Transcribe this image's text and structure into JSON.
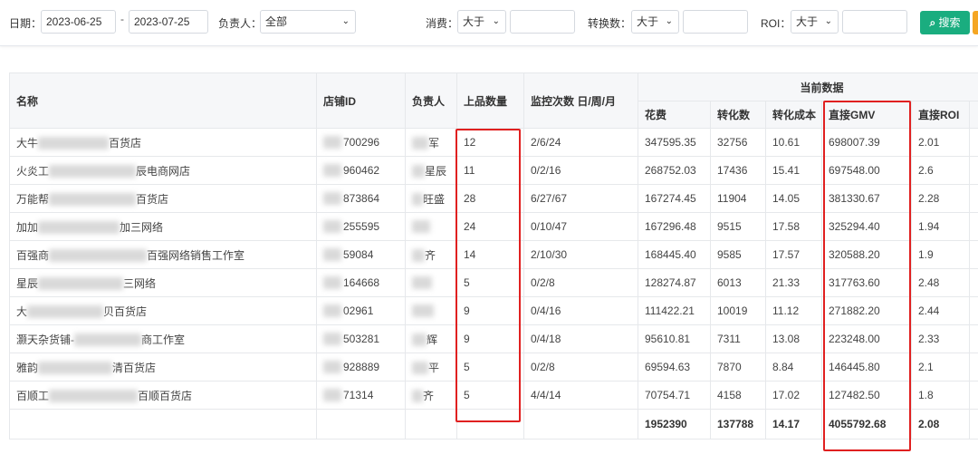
{
  "filters": {
    "date_label": "日期：",
    "date_start": "2023-06-25",
    "date_sep": "-",
    "date_end": "2023-07-25",
    "owner_label": "负责人：",
    "owner_value": "全部",
    "spend_label": "消费：",
    "spend_op": "大于",
    "spend_value": "",
    "conv_label": "转换数：",
    "conv_op": "大于",
    "conv_value": "",
    "roi_label": "ROI：",
    "roi_op": "大于",
    "roi_value": "",
    "search_label": "搜索",
    "chevron": "⌄",
    "search_glyph": "⌕"
  },
  "table": {
    "group_header": "当前数据",
    "columns": {
      "name": "名称",
      "store_id": "店铺ID",
      "owner": "负责人",
      "listed_count": "上品数量",
      "monitor_count": "监控次数 日/周/月",
      "spend": "花费",
      "conversions": "转化数",
      "conv_cost": "转化成本",
      "direct_gmv": "直接GMV",
      "direct_roi": "直接ROI"
    },
    "rows": [
      {
        "name_pre": "大牛",
        "name_post": "百货店",
        "store_id": "700296",
        "owner": "军",
        "listed_count": "12",
        "monitor": "2/6/24",
        "spend": "347595.35",
        "conversions": "32756",
        "conv_cost": "10.61",
        "gmv": "698007.39",
        "roi": "2.01"
      },
      {
        "name_pre": "火炎工",
        "name_post": "辰电商网店",
        "store_id": "960462",
        "owner": "星辰",
        "listed_count": "11",
        "monitor": "0/2/16",
        "spend": "268752.03",
        "conversions": "17436",
        "conv_cost": "15.41",
        "gmv": "697548.00",
        "roi": "2.6"
      },
      {
        "name_pre": "万能帮",
        "name_post": "百货店",
        "store_id": "873864",
        "owner": "旺盛",
        "listed_count": "28",
        "monitor": "6/27/67",
        "spend": "167274.45",
        "conversions": "11904",
        "conv_cost": "14.05",
        "gmv": "381330.67",
        "roi": "2.28"
      },
      {
        "name_pre": "加加",
        "name_post": "加三网络",
        "store_id": "255595",
        "owner": "",
        "listed_count": "24",
        "monitor": "0/10/47",
        "spend": "167296.48",
        "conversions": "9515",
        "conv_cost": "17.58",
        "gmv": "325294.40",
        "roi": "1.94"
      },
      {
        "name_pre": "百强商",
        "name_post": "百强网络销售工作室",
        "store_id": "59084",
        "owner": "齐",
        "listed_count": "14",
        "monitor": "2/10/30",
        "spend": "168445.40",
        "conversions": "9585",
        "conv_cost": "17.57",
        "gmv": "320588.20",
        "roi": "1.9"
      },
      {
        "name_pre": "星辰",
        "name_post": "三网络",
        "store_id": "164668",
        "owner": "",
        "listed_count": "5",
        "monitor": "0/2/8",
        "spend": "128274.87",
        "conversions": "6013",
        "conv_cost": "21.33",
        "gmv": "317763.60",
        "roi": "2.48"
      },
      {
        "name_pre": "大",
        "name_post": "贝百货店",
        "store_id": "02961",
        "owner": "",
        "listed_count": "9",
        "monitor": "0/4/16",
        "spend": "111422.21",
        "conversions": "10019",
        "conv_cost": "11.12",
        "gmv": "271882.20",
        "roi": "2.44"
      },
      {
        "name_pre": "灏天杂货铺-",
        "name_post": "商工作室",
        "store_id": "503281",
        "owner": "辉",
        "listed_count": "9",
        "monitor": "0/4/18",
        "spend": "95610.81",
        "conversions": "7311",
        "conv_cost": "13.08",
        "gmv": "223248.00",
        "roi": "2.33"
      },
      {
        "name_pre": "雅韵",
        "name_post": "清百货店",
        "store_id": "928889",
        "owner": "平",
        "listed_count": "5",
        "monitor": "0/2/8",
        "spend": "69594.63",
        "conversions": "7870",
        "conv_cost": "8.84",
        "gmv": "146445.80",
        "roi": "2.1"
      },
      {
        "name_pre": "百顺工",
        "name_post": "百顺百货店",
        "store_id": "71314",
        "owner": "齐",
        "listed_count": "5",
        "monitor": "4/4/14",
        "spend": "70754.71",
        "conversions": "4158",
        "conv_cost": "17.02",
        "gmv": "127482.50",
        "roi": "1.8"
      }
    ],
    "totals": {
      "spend": "1952390",
      "conversions": "137788",
      "conv_cost": "14.17",
      "gmv": "4055792.68",
      "roi": "2.08"
    }
  },
  "colors": {
    "accent": "#1aad7f",
    "highlight": "#e02020",
    "secondary_button": "#f5a623"
  }
}
